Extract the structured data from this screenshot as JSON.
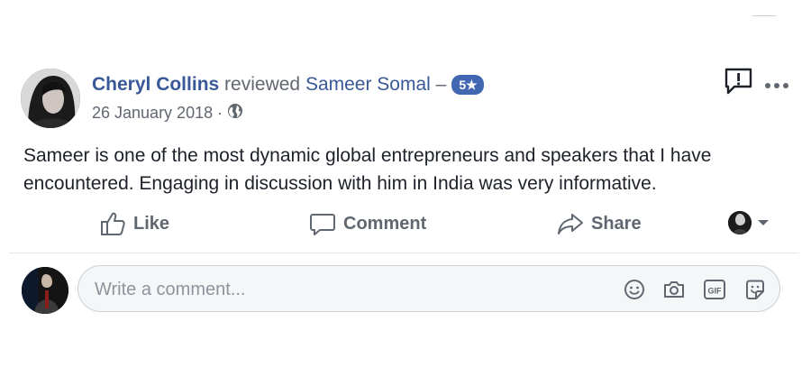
{
  "review": {
    "author": "Cheryl Collins",
    "action_text": "reviewed",
    "subject": "Sameer Somal",
    "separator": "–",
    "rating_badge": "5★",
    "date": "26 January 2018",
    "meta_separator": "·",
    "privacy_icon": "globe-icon",
    "text": "Sameer is one of the most dynamic global entrepreneurs and speakers that I have encountered. Engaging in discussion with him in India was very informative."
  },
  "actions": {
    "like_label": "Like",
    "comment_label": "Comment",
    "share_label": "Share"
  },
  "comment_input": {
    "placeholder": "Write a comment..."
  },
  "colors": {
    "link": "#385898",
    "badge": "#4267b2",
    "muted": "#606770"
  }
}
